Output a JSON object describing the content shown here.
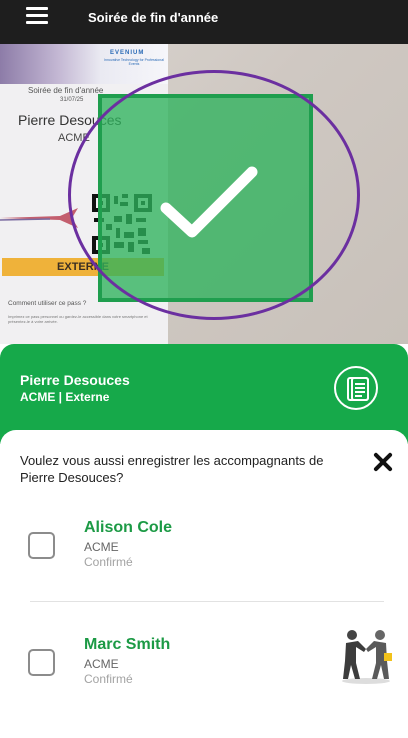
{
  "header": {
    "menu_icon": "hamburger-menu-icon",
    "title": "Soirée de fin d'année"
  },
  "scan": {
    "badge": {
      "brand": "EVENIUM",
      "brand_tagline": "Innovative Technology for Professional Events",
      "event": "Soirée de fin d'année",
      "date": "31/07/25",
      "name": "Pierre Desouces",
      "company": "ACME",
      "category": "EXTERNE",
      "help_title": "Comment utiliser ce pass ?",
      "help_text": "Imprimez ce pass personnel ou gardez-le accessible dans votre smartphone et présentez-le à votre arrivée."
    },
    "status_icon": "checkmark-icon",
    "accent_color": "#2eb25c",
    "circle_color": "#6b2fa0"
  },
  "attendee": {
    "name": "Pierre Desouces",
    "subtitle": "ACME | Externe",
    "details_icon": "document-icon",
    "panel_color": "#16a94a"
  },
  "companions_sheet": {
    "question": "Voulez vous aussi enregistrer les accompagnants de Pierre Desouces?",
    "close_icon": "close-icon",
    "companions": [
      {
        "name": "Alison Cole",
        "company": "ACME",
        "status": "Confirmé",
        "checked": false
      },
      {
        "name": "Marc Smith",
        "company": "ACME",
        "status": "Confirmé",
        "checked": false
      }
    ],
    "name_color": "#1c9a45"
  }
}
